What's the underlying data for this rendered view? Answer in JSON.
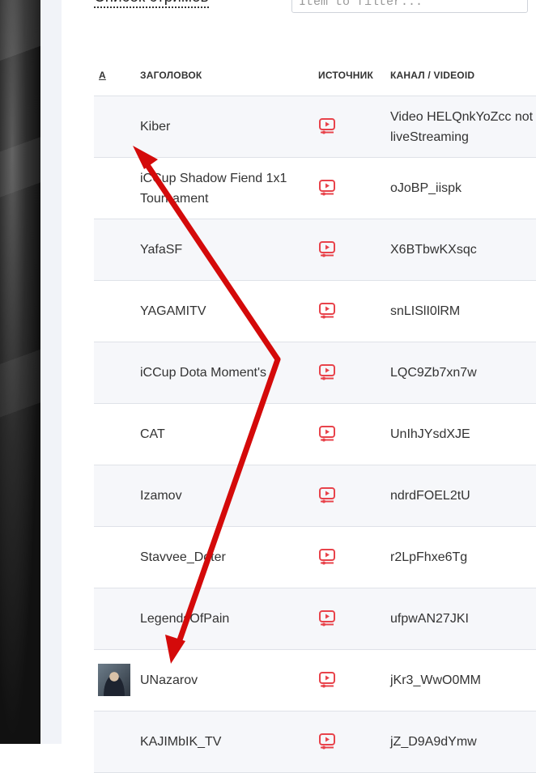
{
  "header": {
    "list_title": "Список стримов",
    "filter_placeholder": "Item to filter..."
  },
  "table": {
    "columns": {
      "avatar": "А",
      "title": "ЗАГОЛОВОК",
      "source": "ИСТОЧНИК",
      "channel": "КАНАЛ / VIDEOID"
    },
    "rows": [
      {
        "title": "Kiber",
        "source_icon": "youtube-play-icon",
        "channel": "Video HELQnkYoZcc not\nliveStreaming",
        "has_avatar": false
      },
      {
        "title": "iCCup Shadow Fiend 1x1 Tournament",
        "source_icon": "youtube-play-icon",
        "channel": "oJoBP_iispk",
        "has_avatar": false
      },
      {
        "title": "YafaSF",
        "source_icon": "youtube-play-icon",
        "channel": "X6BTbwKXsqc",
        "has_avatar": false
      },
      {
        "title": "YAGAMITV",
        "source_icon": "youtube-play-icon",
        "channel": "snLISlI0lRM",
        "has_avatar": false
      },
      {
        "title": "iCCup Dota Moment's",
        "source_icon": "youtube-play-icon",
        "channel": "LQC9Zb7xn7w",
        "has_avatar": false
      },
      {
        "title": "CAT",
        "source_icon": "youtube-play-icon",
        "channel": "UnIhJYsdXJE",
        "has_avatar": false
      },
      {
        "title": "Izamov",
        "source_icon": "youtube-play-icon",
        "channel": "ndrdFOEL2tU",
        "has_avatar": false
      },
      {
        "title": "Stavvee_Doter",
        "source_icon": "youtube-play-icon",
        "channel": "r2LpFhxe6Tg",
        "has_avatar": false
      },
      {
        "title": "LegendsOfPain",
        "source_icon": "youtube-play-icon",
        "channel": "ufpwAN27JKI",
        "has_avatar": false
      },
      {
        "title": "UNazarov",
        "source_icon": "youtube-play-icon",
        "channel": "jKr3_WwO0MM",
        "has_avatar": true
      },
      {
        "title": "KAJIMbIK_TV",
        "source_icon": "youtube-play-icon",
        "channel": "jZ_D9A9dYmw",
        "has_avatar": false
      }
    ]
  },
  "colors": {
    "accent_red": "#e8434b",
    "arrow_red": "#d40a0a",
    "row_alt": "#f6f7fa",
    "border": "#dfe2e8"
  }
}
